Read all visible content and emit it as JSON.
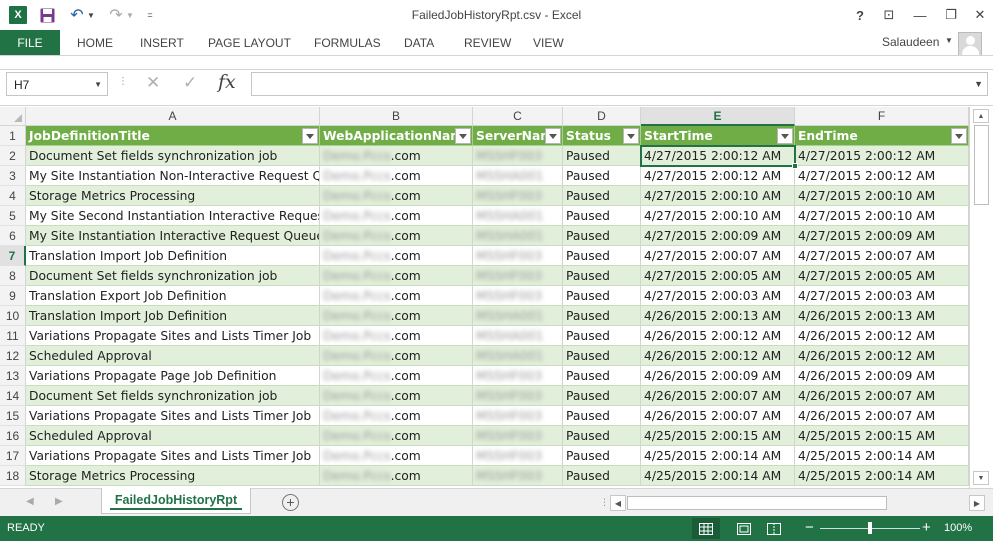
{
  "window": {
    "title": "FailedJobHistoryRpt.csv - Excel",
    "help": "?",
    "ribbon_display": "⊡",
    "minimize": "—",
    "restore": "❐",
    "close": "✕"
  },
  "qat": {
    "excel_logo": "X",
    "save": "",
    "undo": "↶",
    "undo_dropdown": "▼",
    "redo": "↷",
    "redo_dropdown": "▼",
    "customize": "="
  },
  "ribbon": {
    "file": "FILE",
    "tabs": [
      "HOME",
      "INSERT",
      "PAGE LAYOUT",
      "FORMULAS",
      "DATA",
      "REVIEW",
      "VIEW"
    ],
    "user": "Salaudeen"
  },
  "formula_bar": {
    "name_box": "H7",
    "separator": "⋮",
    "cancel": "✕",
    "enter": "✓",
    "insert_function": "fx",
    "value": ""
  },
  "sheet": {
    "selected_cell": "H7",
    "column_letters": [
      "A",
      "B",
      "C",
      "D",
      "E",
      "F"
    ],
    "active_column": "E",
    "active_row": 7,
    "row_numbers": [
      1,
      2,
      3,
      4,
      5,
      6,
      7,
      8,
      9,
      10,
      11,
      12,
      13,
      14,
      15,
      16,
      17,
      18
    ],
    "headers": [
      "JobDefinitionTitle",
      "WebApplicationName",
      "ServerName",
      "Status",
      "StartTime",
      "EndTime"
    ],
    "rows": [
      [
        "Document Set fields synchronization job",
        "Demo.Pccs",
        ".com",
        "MSSHF003",
        "Paused",
        "4/27/2015 2:00:12 AM",
        "4/27/2015 2:00:12 AM"
      ],
      [
        "My Site Instantiation Non-Interactive Request Queue",
        "Demo.Pccs",
        ".com",
        "MSSHA001",
        "Paused",
        "4/27/2015 2:00:12 AM",
        "4/27/2015 2:00:12 AM"
      ],
      [
        "Storage Metrics Processing",
        "Demo.Pccs",
        ".com",
        "MSSHF003",
        "Paused",
        "4/27/2015 2:00:10 AM",
        "4/27/2015 2:00:10 AM"
      ],
      [
        "My Site Second Instantiation Interactive Request Queue",
        "Demo.Pccs",
        ".com",
        "MSSHA001",
        "Paused",
        "4/27/2015 2:00:10 AM",
        "4/27/2015 2:00:10 AM"
      ],
      [
        "My Site Instantiation Interactive Request Queue",
        "Demo.Pccs",
        ".com",
        "MSSHA001",
        "Paused",
        "4/27/2015 2:00:09 AM",
        "4/27/2015 2:00:09 AM"
      ],
      [
        "Translation Import Job Definition",
        "Demo.Pccs",
        ".com",
        "MSSHF003",
        "Paused",
        "4/27/2015 2:00:07 AM",
        "4/27/2015 2:00:07 AM"
      ],
      [
        "Document Set fields synchronization job",
        "Demo.Pccs",
        ".com",
        "MSSHF003",
        "Paused",
        "4/27/2015 2:00:05 AM",
        "4/27/2015 2:00:05 AM"
      ],
      [
        "Translation Export Job Definition",
        "Demo.Pccs",
        ".com",
        "MSSHF003",
        "Paused",
        "4/27/2015 2:00:03 AM",
        "4/27/2015 2:00:03 AM"
      ],
      [
        "Translation Import Job Definition",
        "Demo.Pccs",
        ".com",
        "MSSHA001",
        "Paused",
        "4/26/2015 2:00:13 AM",
        "4/26/2015 2:00:13 AM"
      ],
      [
        "Variations Propagate Sites and Lists Timer Job",
        "Demo.Pccs",
        ".com",
        "MSSHA001",
        "Paused",
        "4/26/2015 2:00:12 AM",
        "4/26/2015 2:00:12 AM"
      ],
      [
        "Scheduled Approval",
        "Demo.Pccs",
        ".com",
        "MSSHA001",
        "Paused",
        "4/26/2015 2:00:12 AM",
        "4/26/2015 2:00:12 AM"
      ],
      [
        "Variations Propagate Page Job Definition",
        "Demo.Pccs",
        ".com",
        "MSSHF003",
        "Paused",
        "4/26/2015 2:00:09 AM",
        "4/26/2015 2:00:09 AM"
      ],
      [
        "Document Set fields synchronization job",
        "Demo.Pccs",
        ".com",
        "MSSHF003",
        "Paused",
        "4/26/2015 2:00:07 AM",
        "4/26/2015 2:00:07 AM"
      ],
      [
        "Variations Propagate Sites and Lists Timer Job",
        "Demo.Pccs",
        ".com",
        "MSSHF003",
        "Paused",
        "4/26/2015 2:00:07 AM",
        "4/26/2015 2:00:07 AM"
      ],
      [
        "Scheduled Approval",
        "Demo.Pccs",
        ".com",
        "MSSHF003",
        "Paused",
        "4/25/2015 2:00:15 AM",
        "4/25/2015 2:00:15 AM"
      ],
      [
        "Variations Propagate Sites and Lists Timer Job",
        "Demo.Pccs",
        ".com",
        "MSSHF003",
        "Paused",
        "4/25/2015 2:00:14 AM",
        "4/25/2015 2:00:14 AM"
      ],
      [
        "Storage Metrics Processing",
        "Demo.Pccs",
        ".com",
        "MSSHF003",
        "Paused",
        "4/25/2015 2:00:14 AM",
        "4/25/2015 2:00:14 AM"
      ]
    ]
  },
  "sheet_tabs": {
    "prev": "◀",
    "next": "▶",
    "active": "FailedJobHistoryRpt",
    "new_sheet": "+"
  },
  "status_bar": {
    "status": "READY",
    "zoom_out": "−",
    "zoom_in": "+",
    "zoom_level": "100%",
    "zoom_fraction": 0.5
  },
  "colors": {
    "excel_green": "#217346",
    "table_header": "#70ad47",
    "band_row": "#e2efda"
  }
}
